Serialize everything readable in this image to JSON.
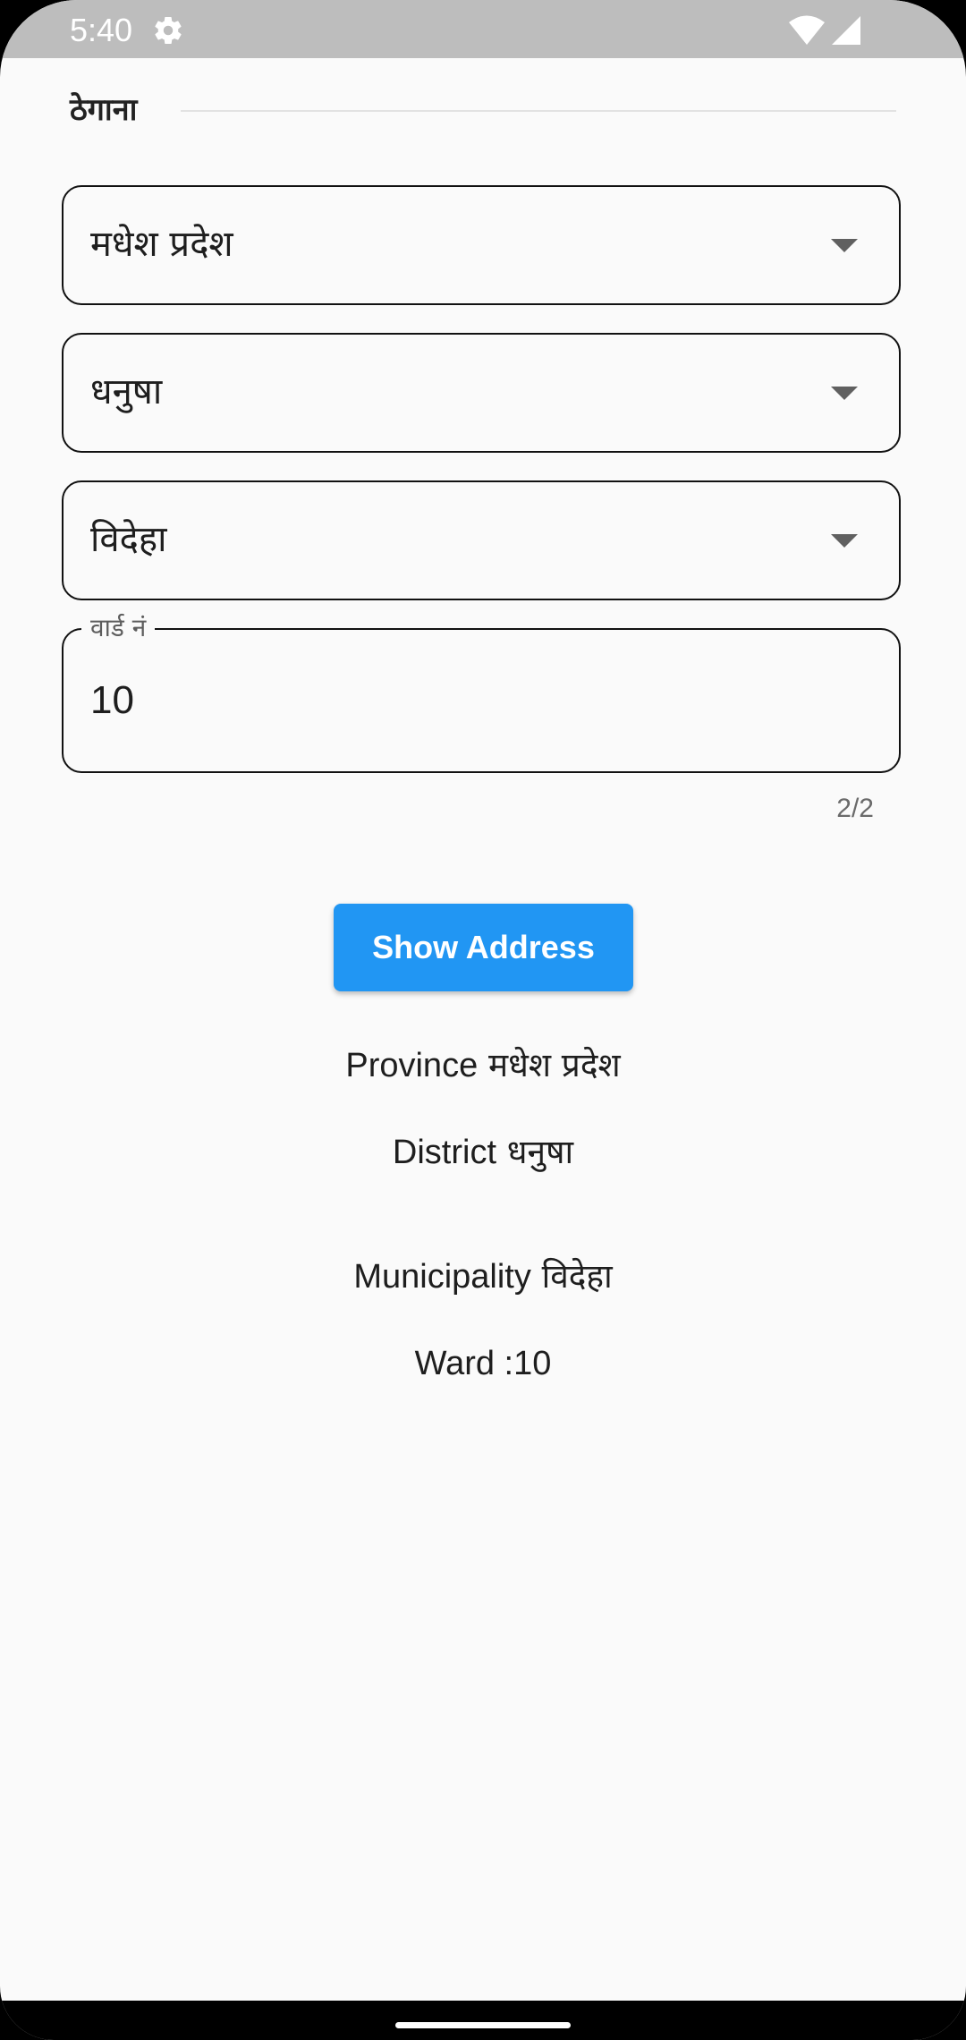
{
  "status_bar": {
    "time": "5:40",
    "icons": [
      "gear-icon",
      "wifi-icon",
      "signal-icon"
    ]
  },
  "section": {
    "title": "ठेगाना"
  },
  "dropdowns": {
    "province": "मधेश प्रदेश",
    "district": "धनुषा",
    "municipality": "विदेहा"
  },
  "ward_field": {
    "label": "वार्ड नं",
    "value": "10",
    "counter": "2/2"
  },
  "button": {
    "label": "Show Address"
  },
  "results": {
    "province_label": "Province",
    "province_value": "मधेश प्रदेश",
    "district_label": "District",
    "district_value": "धनुषा",
    "municipality_label": "Municipality",
    "municipality_value": "विदेहा",
    "ward_text": "Ward :10"
  },
  "colors": {
    "accent": "#2196f3",
    "status_bar": "#bdbdbd",
    "background": "#fafafa"
  }
}
